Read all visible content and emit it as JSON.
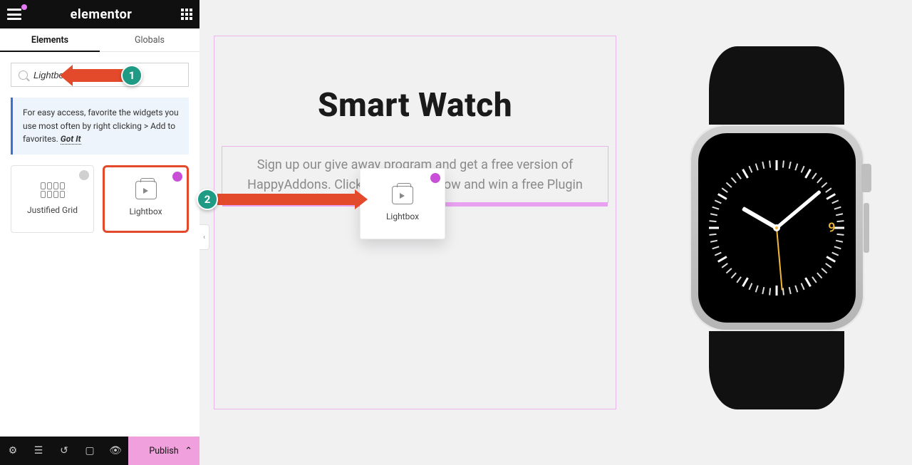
{
  "header": {
    "brand": "elementor"
  },
  "tabs": {
    "elements": "Elements",
    "globals": "Globals"
  },
  "search": {
    "value": "Lightbox"
  },
  "notice": {
    "text": "For easy access, favorite the widgets you use most often by right clicking > Add to favorites.",
    "got_it": "Got It"
  },
  "widgets": {
    "justified": "Justified Grid",
    "lightbox": "Lightbox"
  },
  "ghost": {
    "label": "Lightbox"
  },
  "bottom": {
    "publish": "Publish"
  },
  "canvas": {
    "heading": "Smart Watch",
    "paragraph": "Sign up our give away program and get a free version of HappyAddons. Click the button below and win a free Plugin"
  },
  "watch": {
    "dial_number": "9"
  },
  "markers": {
    "one": "1",
    "two": "2"
  },
  "collapse": {
    "glyph": "‹"
  }
}
